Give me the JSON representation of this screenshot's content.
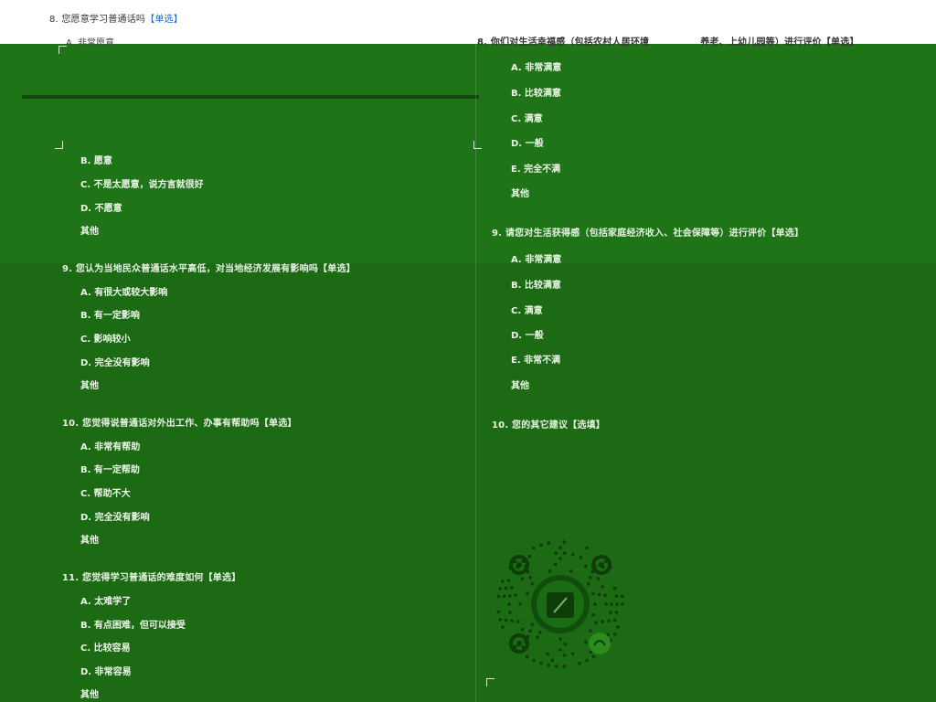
{
  "left": {
    "q8": {
      "title": "8. 您愿意学习普通话吗",
      "tag": "【单选】",
      "options": [
        "A. 非常愿意",
        "B. 愿意",
        "C. 不是太愿意，说方言就很好",
        "D. 不愿意",
        "其他"
      ]
    },
    "q9": {
      "title": "9. 您认为当地民众普通话水平高低，对当地经济发展有影响吗",
      "tag": "【单选】",
      "options": [
        "A. 有很大或较大影响",
        "B. 有一定影响",
        "C. 影响较小",
        "D. 完全没有影响",
        "其他"
      ]
    },
    "q10": {
      "title": "10. 您觉得说普通话对外出工作、办事有帮助吗",
      "tag": "【单选】",
      "options": [
        "A. 非常有帮助",
        "B. 有一定帮助",
        "C. 帮助不大",
        "D. 完全没有影响",
        "其他"
      ]
    },
    "q11": {
      "title": "11. 您觉得学习普通话的难度如何",
      "tag": "【单选】",
      "options": [
        "A. 太难学了",
        "B. 有点困难，但可以接受",
        "C. 比较容易",
        "D. 非常容易",
        "其他"
      ]
    }
  },
  "right": {
    "q8": {
      "title": "8. 你们对生活幸福感（包括农村人居环境",
      "title_tail": "养老、上幼儿园等）进行评价",
      "tag": "【单选】",
      "options": [
        "A. 非常满意",
        "B. 比较满意",
        "C. 满意",
        "D. 一般",
        "E. 完全不满",
        "其他"
      ]
    },
    "q9": {
      "title": "9. 请您对生活获得感（包括家庭经济收入、社会保障等）进行评价",
      "tag": "【单选】",
      "options": [
        "A. 非常满意",
        "B. 比较满意",
        "C. 满意",
        "D. 一般",
        "E. 非常不满",
        "其他"
      ]
    },
    "q10": {
      "title": "10. 您的其它建议",
      "tag": "【选填】"
    }
  },
  "qr": {
    "icon": "mini-program-qr-code"
  }
}
